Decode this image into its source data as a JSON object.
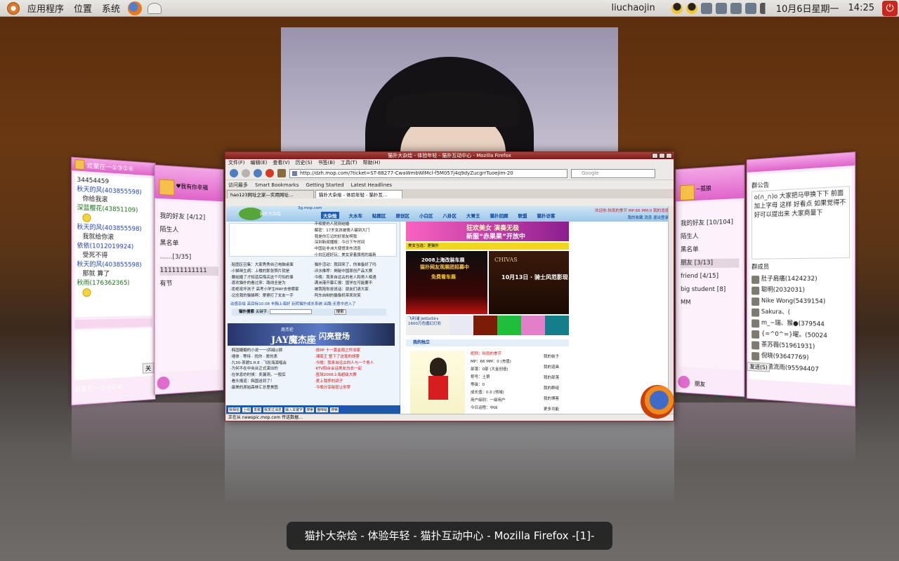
{
  "panel": {
    "menus": [
      "应用程序",
      "位置",
      "系统"
    ],
    "user": "liuchaojin",
    "date": "10月6日星期一",
    "time": "14:25"
  },
  "qq_chat_left": {
    "title": "欢聚在一①③①④",
    "number": "34454459",
    "lines": [
      {
        "who": "秋天的风(403855598)",
        "time": "14:20",
        "msg": "你给我滚"
      },
      {
        "who": "深蓝樱花(43851109)",
        "time": "14:20",
        "msg": ""
      },
      {
        "who": "秋天的风(403855598)",
        "time": "14:20",
        "msg": "我就给你滚"
      },
      {
        "who": "依依(1012019924)",
        "time": "14:21:08",
        "msg": "受死不得"
      },
      {
        "who": "秋天的风(403855598)",
        "time": "14:21",
        "msg": "那就 算了"
      },
      {
        "who": "秋雨(176362365)",
        "time": "14:22:09",
        "msg": ""
      }
    ],
    "bottom_label": "欢聚在一①③①④",
    "send_btn": "关"
  },
  "qq_list_left": {
    "status": "♥我有你幸福",
    "items": [
      "我的好友 [4/12]",
      "陌生人",
      "黑名单",
      "……[3/35]",
      "111111111111",
      "有节"
    ]
  },
  "qq_list_right": {
    "status": "~孤狼",
    "items": [
      "我的好友 [10/104]",
      "陌生人",
      "黑名单",
      "朋友 [3/13]",
      "friend [4/15]",
      "big student [8]",
      "MM"
    ],
    "bottom": "朋友"
  },
  "qq_chat_right": {
    "notice_title": "群公告",
    "notice": "o(∩_∩)o 大家把马甲换下下 前面加上字母 这样 好看点 如果觉得不好可以提出来 大家商量下",
    "members_title": "群成员",
    "members": [
      "肚子肩痛(1424232)",
      "聪明(2032031)",
      "Nike Wong(5439154)",
      "Sakura、(",
      "m_~瑞、猴●(379544",
      "{=^0^=}曜。(50024",
      "茶苏薇(51961931)",
      "倪晓(93647769)",
      "心晴流雨(95594407"
    ],
    "send_btn": "发送(S)"
  },
  "firefox": {
    "title": "猫扑大杂烩 - 体验年轻 - 猫扑互动中心 - Mozilla Firefox",
    "menu": [
      "文件(F)",
      "编辑(E)",
      "查看(V)",
      "历史(S)",
      "书签(B)",
      "工具(T)",
      "帮助(H)"
    ],
    "url": "http://dzh.mop.com/?ticket=ST-88277-CwaWmbWlMcl-f5M057j4q9dyZucgrrTuoejim-20",
    "search_placeholder": "Google",
    "bookmarks": [
      "访问最多",
      "Smart Bookmarks",
      "Getting Started",
      "Latest Headlines"
    ],
    "tabs": [
      "hao123网址之家—实用网址…",
      "猫扑大杂烩 - 体验年轻 - 猫扑互…"
    ],
    "status": "正在从 newspic.mop.com 传送数据…"
  },
  "page": {
    "logo_text": "猫扑大杂烩",
    "site": "3g.mop.com",
    "nav": [
      "大杂烩",
      "大水车",
      "贴图区",
      "原创区",
      "小白区",
      "八卦区",
      "大胃王",
      "猫扑回顾",
      "联盟",
      "猫扑访客"
    ],
    "welcome": "欢迎你:秋雨的季节  MP:66  MM:0  我的消息",
    "welcome2": "我的收藏  消息  退出登录",
    "list1": [
      "·不相爱的人就别结婚",
      "·解密：17岁女孩被情人骗到大门",
      "·我是你忘记的好朋友啊我",
      "·深圳新闻播报：今日下午时间",
      "·中国驻非洲大使馆发布消息",
      "·小白区超好玩：美女穿着旗袍的最新"
    ],
    "list2": [
      "·贴图区召集：大家秀秀自己电脑桌面",
      "·小猫咪生病：上楼的那张照片就是",
      "·要结婚了才知道后悔买这个可怕的事",
      "·喜欢猫扑的看过来：路线全是为",
      "·拒绝宠坏孩子 高考小学生MAY去他哪家",
      "·记念我的猫猫啊：摩擦打了女友一手"
    ],
    "list3": [
      "·猫扑活动：我回来了，你准备好了吗",
      "·评水推荐：揭秘中国原创产品大赛",
      "·今晚：我来自远古的老人和男人相遇",
      "·满洲港开幕汇报：国学在可能要不",
      "·被我陪你说说话：朋友们请大家",
      "·阿东自制的摄像机带来欢笑"
    ],
    "hot_links": "动感杂烩  高目标10.08  丰胸上海好  玩转猫扑成长系统  出路:无意中进入了",
    "search_label": "猫扑搜索",
    "search_key": "关键字:",
    "search_btn": "搜索",
    "jay_small": "周杰伦",
    "jay_big": "JAY魔杰座",
    "jay_right": "闪亮登场",
    "news_left": [
      "·韩国蝦蝦的小说一一(四级)(嫁",
      "·墙体 · 等待 · 找你 · 爱的表",
      "·九30-茶貌S.H.E · 飞轮海演唱会",
      "·为何不在中央台正式演出的",
      "·在休息的时候：卖漏洞，一般后",
      "·看头报道：韩国送到了！",
      "·最美的原始森林汇总里美图"
    ],
    "news_right": [
      "·放PP 十一黄金周之怀旧家",
      "·湘南王 整下了这笔的胡萝",
      "·今晚：我来自远古的人与一个男人",
      "·KTV阳台会话男友白衣一起",
      "·篮球2008上海超级大赛",
      "·爱上我养的鸽子",
      "·今晚分享秘密让你梦"
    ],
    "bottom_btns": [
      "我相信",
      "上线",
      "发稿",
      "我发过消息",
      "输入关键字",
      "搜索",
      "猫咪粘",
      "搜索"
    ],
    "banner1_a": "狂欢美女  演奏无极",
    "banner1_b": "新服“赤果果”开放中",
    "yellow_bar": "美女当选：更猫扑",
    "car_a": "2008上海改装车展",
    "car_b": "猫扑网友观展团招募中",
    "car_c": "免费看车展",
    "chivas_a": "CHIVAS",
    "chivas_b": "10月13日 · 骑士风范影现",
    "strip_cap_1": "飞利浦 JetGoSirs",
    "strip_cap_2": "1600万色魔幻灯彩",
    "sec_title": "我的独立",
    "profile": [
      "昵称：秋雨的季节",
      "MP：66 MM：0 (充值)",
      "部落：0部 (大金创造)",
      "称号：土狼",
      "等级：0",
      "成长值：0.0 (领域)",
      "用户级别：一级用户",
      "今日运程：中凶"
    ],
    "side_links": [
      "我的帖子",
      "我的道具",
      "我的部落",
      "我的群组",
      "我的博客",
      "更多功能"
    ]
  },
  "switcher": {
    "caption": "猫扑大杂烩 - 体验年轻 - 猫扑互动中心 - Mozilla Firefox -[1]-"
  }
}
